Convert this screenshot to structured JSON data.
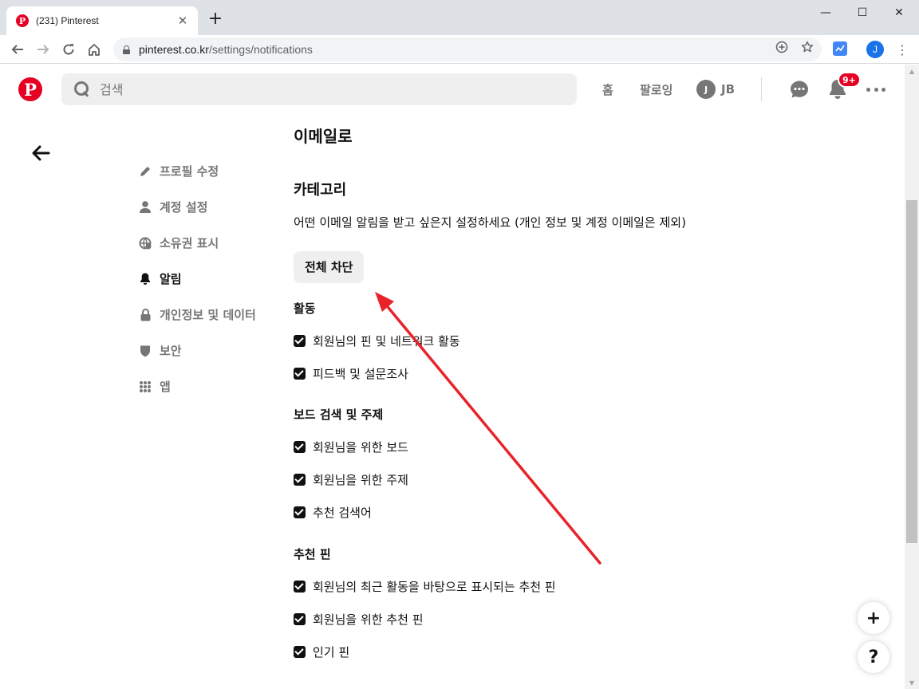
{
  "browser": {
    "tab_title": "(231) Pinterest",
    "url_host": "pinterest.co.kr",
    "url_path": "/settings/notifications",
    "profile_initial": "J"
  },
  "header": {
    "search_placeholder": "검색",
    "home_label": "홈",
    "following_label": "팔로잉",
    "avatar_initial": "J",
    "user_name": "JB",
    "notification_badge": "9+"
  },
  "sidebar": {
    "items": [
      {
        "label": "프로필 수정",
        "icon": "pencil-icon"
      },
      {
        "label": "계정 설정",
        "icon": "person-icon"
      },
      {
        "label": "소유권 표시",
        "icon": "globe-icon"
      },
      {
        "label": "알림",
        "icon": "bell-icon",
        "active": true
      },
      {
        "label": "개인정보 및 데이터",
        "icon": "lock-icon"
      },
      {
        "label": "보안",
        "icon": "shield-icon"
      },
      {
        "label": "앱",
        "icon": "apps-grid-icon"
      }
    ]
  },
  "main": {
    "page_title": "이메일로",
    "section_title": "카테고리",
    "section_desc": "어떤 이메일 알림을 받고 싶은지 설정하세요 (개인 정보 및 계정 이메일은 제외)",
    "block_all_label": "전체 차단",
    "groups": [
      {
        "title": "활동",
        "items": [
          "회원님의 핀 및 네트워크 활동",
          "피드백 및 설문조사"
        ]
      },
      {
        "title": "보드 검색 및 주제",
        "items": [
          "회원님을 위한 보드",
          "회원님을 위한 주제",
          "추천 검색어"
        ]
      },
      {
        "title": "추천 핀",
        "items": [
          "회원님의 최근 활동을 바탕으로 표시되는 추천 핀",
          "회원님을 위한 추천 핀",
          "인기 핀"
        ]
      }
    ]
  },
  "fab": {
    "add_label": "+",
    "help_label": "?"
  },
  "colors": {
    "brand": "#e60023",
    "annotation_arrow": "#e8232a"
  }
}
